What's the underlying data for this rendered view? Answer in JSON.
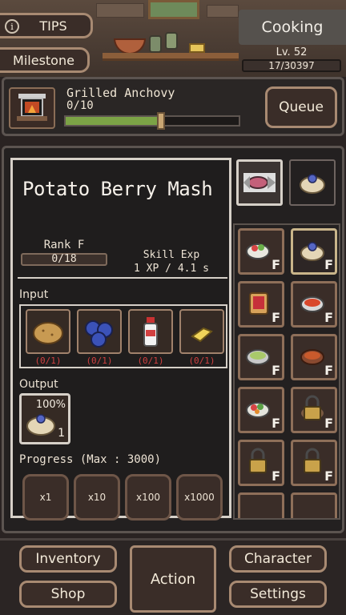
{
  "header": {
    "tips_label": "TIPS",
    "milestone_label": "Milestone",
    "skill_name": "Cooking",
    "level_label": "Lv. 52",
    "xp_text": "17/30397"
  },
  "activity": {
    "name": "Grilled Anchovy",
    "count": "0/10",
    "progress": 0.55,
    "queue_label": "Queue"
  },
  "recipe": {
    "title": "Potato Berry Mash",
    "rank_label": "Rank F",
    "rank_progress": "0/18",
    "skill_exp_label": "Skill Exp",
    "skill_exp_value": "1 XP / 4.1 s",
    "input_label": "Input",
    "inputs": [
      {
        "icon": "potato-icon",
        "need": "(0/1)"
      },
      {
        "icon": "blueberries-icon",
        "need": "(0/1)"
      },
      {
        "icon": "milk-bottle-icon",
        "need": "(0/1)"
      },
      {
        "icon": "butter-icon",
        "need": "(0/1)"
      }
    ],
    "output_label": "Output",
    "output": {
      "icon": "potato-berry-mash-icon",
      "chance": "100%",
      "qty": "1"
    },
    "progress_label": "Progress (Max : 3000)",
    "multipliers": [
      "x1",
      "x10",
      "x100",
      "x1000"
    ]
  },
  "recipe_list": [
    {
      "icon": "salad-bowl-icon",
      "rank": "F",
      "locked": false
    },
    {
      "icon": "potato-berry-mash-icon",
      "rank": "F",
      "locked": false,
      "selected": true
    },
    {
      "icon": "jam-toast-icon",
      "rank": "F",
      "locked": false
    },
    {
      "icon": "tomato-soup-icon",
      "rank": "F",
      "locked": false
    },
    {
      "icon": "green-stew-icon",
      "rank": "F",
      "locked": false
    },
    {
      "icon": "chili-bowl-icon",
      "rank": "F",
      "locked": false
    },
    {
      "icon": "veggie-bowl-icon",
      "rank": "F",
      "locked": false
    },
    {
      "icon": "lock-icon",
      "rank": "F",
      "locked": true
    },
    {
      "icon": "lock-icon",
      "rank": "F",
      "locked": true
    },
    {
      "icon": "lock-icon",
      "rank": "F",
      "locked": true
    }
  ],
  "nav": {
    "inventory": "Inventory",
    "shop": "Shop",
    "action": "Action",
    "character": "Character",
    "settings": "Settings"
  },
  "colors": {
    "progress_green": "#7ca346",
    "need_red": "#d04040",
    "accent_border": "#a88a72"
  }
}
